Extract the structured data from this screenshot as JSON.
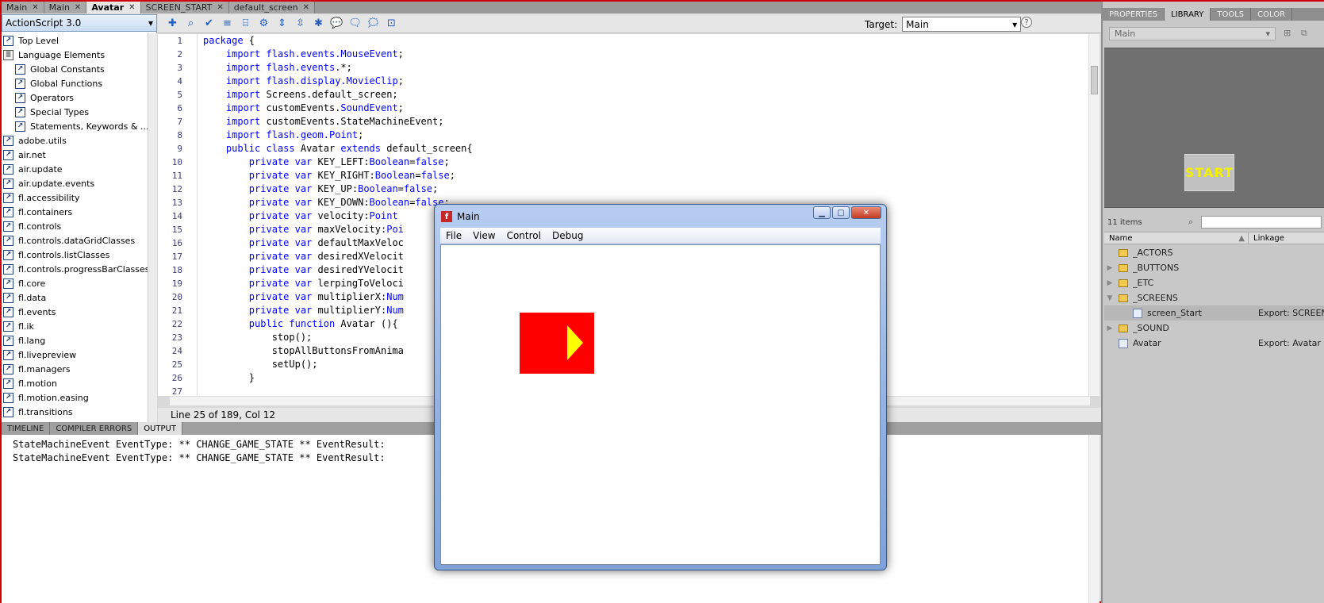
{
  "doc_tabs": [
    {
      "label": "Main",
      "active": false
    },
    {
      "label": "Main",
      "active": false
    },
    {
      "label": "Avatar",
      "active": true
    },
    {
      "label": "SCREEN_START",
      "active": false
    },
    {
      "label": "default_screen",
      "active": false
    }
  ],
  "lang_select": "ActionScript 3.0",
  "lib_tree": [
    {
      "label": "Top Level",
      "indent": 0,
      "icon": "package"
    },
    {
      "label": "Language Elements",
      "indent": 0,
      "icon": "book"
    },
    {
      "label": "Global Constants",
      "indent": 1,
      "icon": "package"
    },
    {
      "label": "Global Functions",
      "indent": 1,
      "icon": "package"
    },
    {
      "label": "Operators",
      "indent": 1,
      "icon": "package"
    },
    {
      "label": "Special Types",
      "indent": 1,
      "icon": "package"
    },
    {
      "label": "Statements, Keywords & ...",
      "indent": 1,
      "icon": "package"
    },
    {
      "label": "adobe.utils",
      "indent": 0,
      "icon": "package"
    },
    {
      "label": "air.net",
      "indent": 0,
      "icon": "package"
    },
    {
      "label": "air.update",
      "indent": 0,
      "icon": "package"
    },
    {
      "label": "air.update.events",
      "indent": 0,
      "icon": "package"
    },
    {
      "label": "fl.accessibility",
      "indent": 0,
      "icon": "package"
    },
    {
      "label": "fl.containers",
      "indent": 0,
      "icon": "package"
    },
    {
      "label": "fl.controls",
      "indent": 0,
      "icon": "package"
    },
    {
      "label": "fl.controls.dataGridClasses",
      "indent": 0,
      "icon": "package"
    },
    {
      "label": "fl.controls.listClasses",
      "indent": 0,
      "icon": "package"
    },
    {
      "label": "fl.controls.progressBarClasses",
      "indent": 0,
      "icon": "package"
    },
    {
      "label": "fl.core",
      "indent": 0,
      "icon": "package"
    },
    {
      "label": "fl.data",
      "indent": 0,
      "icon": "package"
    },
    {
      "label": "fl.events",
      "indent": 0,
      "icon": "package"
    },
    {
      "label": "fl.ik",
      "indent": 0,
      "icon": "package"
    },
    {
      "label": "fl.lang",
      "indent": 0,
      "icon": "package"
    },
    {
      "label": "fl.livepreview",
      "indent": 0,
      "icon": "package"
    },
    {
      "label": "fl.managers",
      "indent": 0,
      "icon": "package"
    },
    {
      "label": "fl.motion",
      "indent": 0,
      "icon": "package"
    },
    {
      "label": "fl.motion.easing",
      "indent": 0,
      "icon": "package"
    },
    {
      "label": "fl.transitions",
      "indent": 0,
      "icon": "package"
    }
  ],
  "toolbar": {
    "target_label": "Target:",
    "target_value": "Main"
  },
  "code_lines": [
    {
      "n": "1",
      "text": "package {"
    },
    {
      "n": "2",
      "text": "    import flash.events.MouseEvent;"
    },
    {
      "n": "3",
      "text": "    import flash.events.*;"
    },
    {
      "n": "4",
      "text": "    import flash.display.MovieClip;"
    },
    {
      "n": "5",
      "text": "    import Screens.default_screen;"
    },
    {
      "n": "6",
      "text": "    import customEvents.SoundEvent;"
    },
    {
      "n": "7",
      "text": "    import customEvents.StateMachineEvent;"
    },
    {
      "n": "8",
      "text": "    import flash.geom.Point;"
    },
    {
      "n": "9",
      "text": "    public class Avatar extends default_screen{"
    },
    {
      "n": "10",
      "text": "        private var KEY_LEFT:Boolean=false;"
    },
    {
      "n": "11",
      "text": "        private var KEY_RIGHT:Boolean=false;"
    },
    {
      "n": "12",
      "text": "        private var KEY_UP:Boolean=false;"
    },
    {
      "n": "13",
      "text": "        private var KEY_DOWN:Boolean=false;"
    },
    {
      "n": "14",
      "text": "        private var velocity:Point"
    },
    {
      "n": "15",
      "text": "        private var maxVelocity:Poi"
    },
    {
      "n": "16",
      "text": "        private var defaultMaxVeloc"
    },
    {
      "n": "17",
      "text": "        private var desiredXVelocit"
    },
    {
      "n": "18",
      "text": "        private var desiredYVelocit"
    },
    {
      "n": "19",
      "text": "        private var lerpingToVeloci"
    },
    {
      "n": "20",
      "text": "        private var multiplierX:Num"
    },
    {
      "n": "21",
      "text": "        private var multiplierY:Num"
    },
    {
      "n": "22",
      "text": "        public function Avatar (){"
    },
    {
      "n": "23",
      "text": "            stop();"
    },
    {
      "n": "24",
      "text": "            stopAllButtonsFromAnima"
    },
    {
      "n": "25",
      "text": "            setUp();"
    },
    {
      "n": "26",
      "text": "        }"
    },
    {
      "n": "27",
      "text": ""
    }
  ],
  "status_line": "Line 25 of 189, Col 12",
  "bottom_tabs": [
    {
      "label": "TIMELINE",
      "active": false
    },
    {
      "label": "COMPILER ERRORS",
      "active": false
    },
    {
      "label": "OUTPUT",
      "active": true
    }
  ],
  "output_lines": [
    "StateMachineEvent EventType: ** CHANGE_GAME_STATE ** EventResult: ",
    "StateMachineEvent EventType: ** CHANGE_GAME_STATE ** EventResult: "
  ],
  "right_tabs": [
    {
      "label": "PROPERTIES",
      "active": false
    },
    {
      "label": "LIBRARY",
      "active": true
    },
    {
      "label": "TOOLS",
      "active": false
    },
    {
      "label": "COLOR",
      "active": false
    }
  ],
  "library": {
    "doc_select": "Main",
    "preview_text": "START",
    "items_count": "11 items",
    "col_name": "Name",
    "col_linkage": "Linkage",
    "rows": [
      {
        "name": "_ACTORS",
        "type": "folder",
        "indent": 0,
        "arrow": "",
        "linkage": "",
        "selected": false
      },
      {
        "name": "_BUTTONS",
        "type": "folder",
        "indent": 0,
        "arrow": "▶",
        "linkage": "",
        "selected": false
      },
      {
        "name": "_ETC",
        "type": "folder",
        "indent": 0,
        "arrow": "▶",
        "linkage": "",
        "selected": false
      },
      {
        "name": "_SCREENS",
        "type": "folder",
        "indent": 0,
        "arrow": "▼",
        "linkage": "",
        "selected": false
      },
      {
        "name": "screen_Start",
        "type": "symbol",
        "indent": 1,
        "arrow": "",
        "linkage": "Export: SCREEN_",
        "selected": true
      },
      {
        "name": "_SOUND",
        "type": "folder",
        "indent": 0,
        "arrow": "▶",
        "linkage": "",
        "selected": false
      },
      {
        "name": "Avatar",
        "type": "symbol",
        "indent": 0,
        "arrow": "",
        "linkage": "Export: Avatar",
        "selected": false
      }
    ]
  },
  "player": {
    "title": "Main",
    "menu": [
      "File",
      "View",
      "Control",
      "Debug"
    ]
  },
  "colors": {
    "stage_button": "#ff0000",
    "stage_arrow": "#ffff00",
    "keyword": "#0000ff"
  }
}
